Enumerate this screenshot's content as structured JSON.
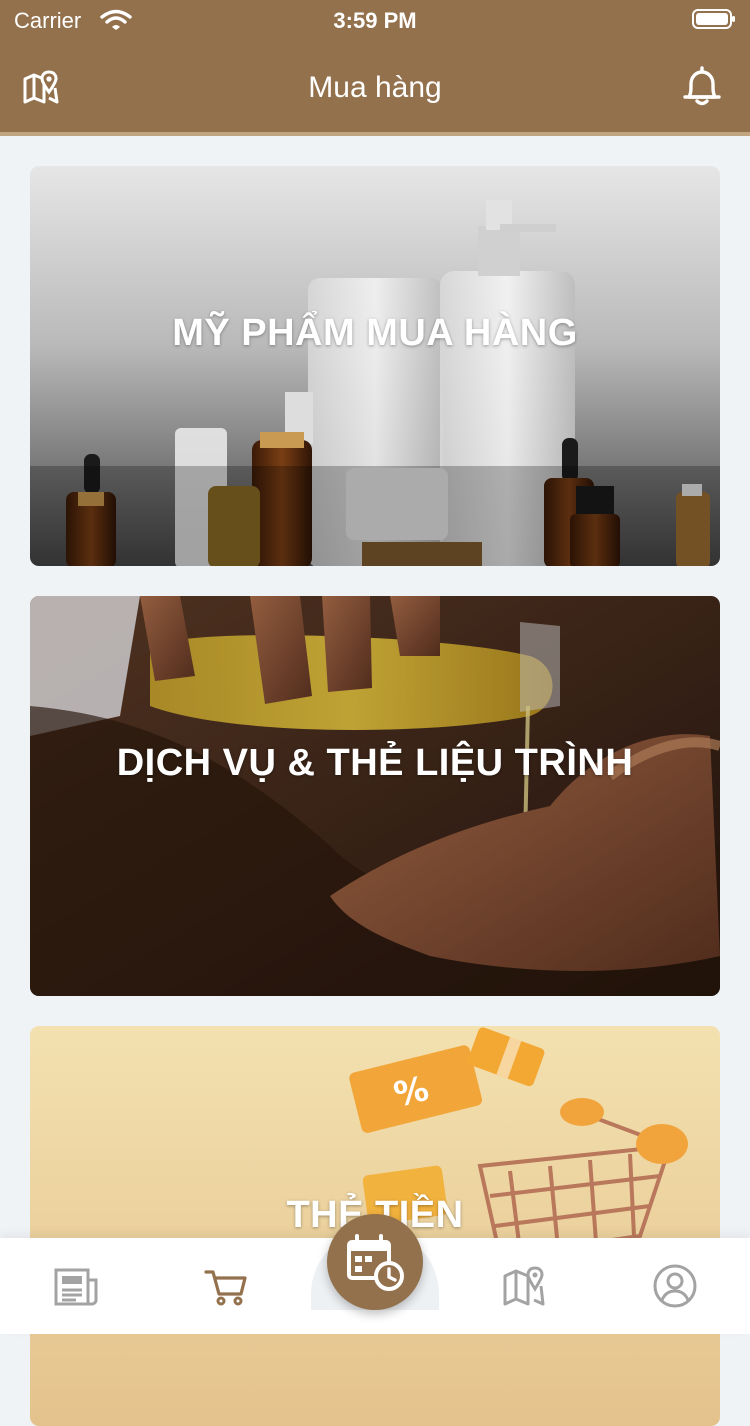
{
  "status_bar": {
    "carrier": "Carrier",
    "time": "3:59 PM"
  },
  "header": {
    "title": "Mua hàng"
  },
  "icons": {
    "left": "map-pin-icon",
    "right": "bell-icon"
  },
  "categories": [
    {
      "label": "MỸ PHẨM MUA HÀNG"
    },
    {
      "label": "DỊCH VỤ & THẺ LIỆU TRÌNH"
    },
    {
      "label": "THẺ TIỀN"
    }
  ],
  "tabbar": {
    "items": [
      "news-icon",
      "cart-icon",
      "calendar-clock-icon",
      "map-icon",
      "user-icon"
    ],
    "active": "cart-icon"
  },
  "colors": {
    "brand": "#93714c",
    "active_tab": "#93714c",
    "inactive_tab": "#a3a3a3"
  }
}
